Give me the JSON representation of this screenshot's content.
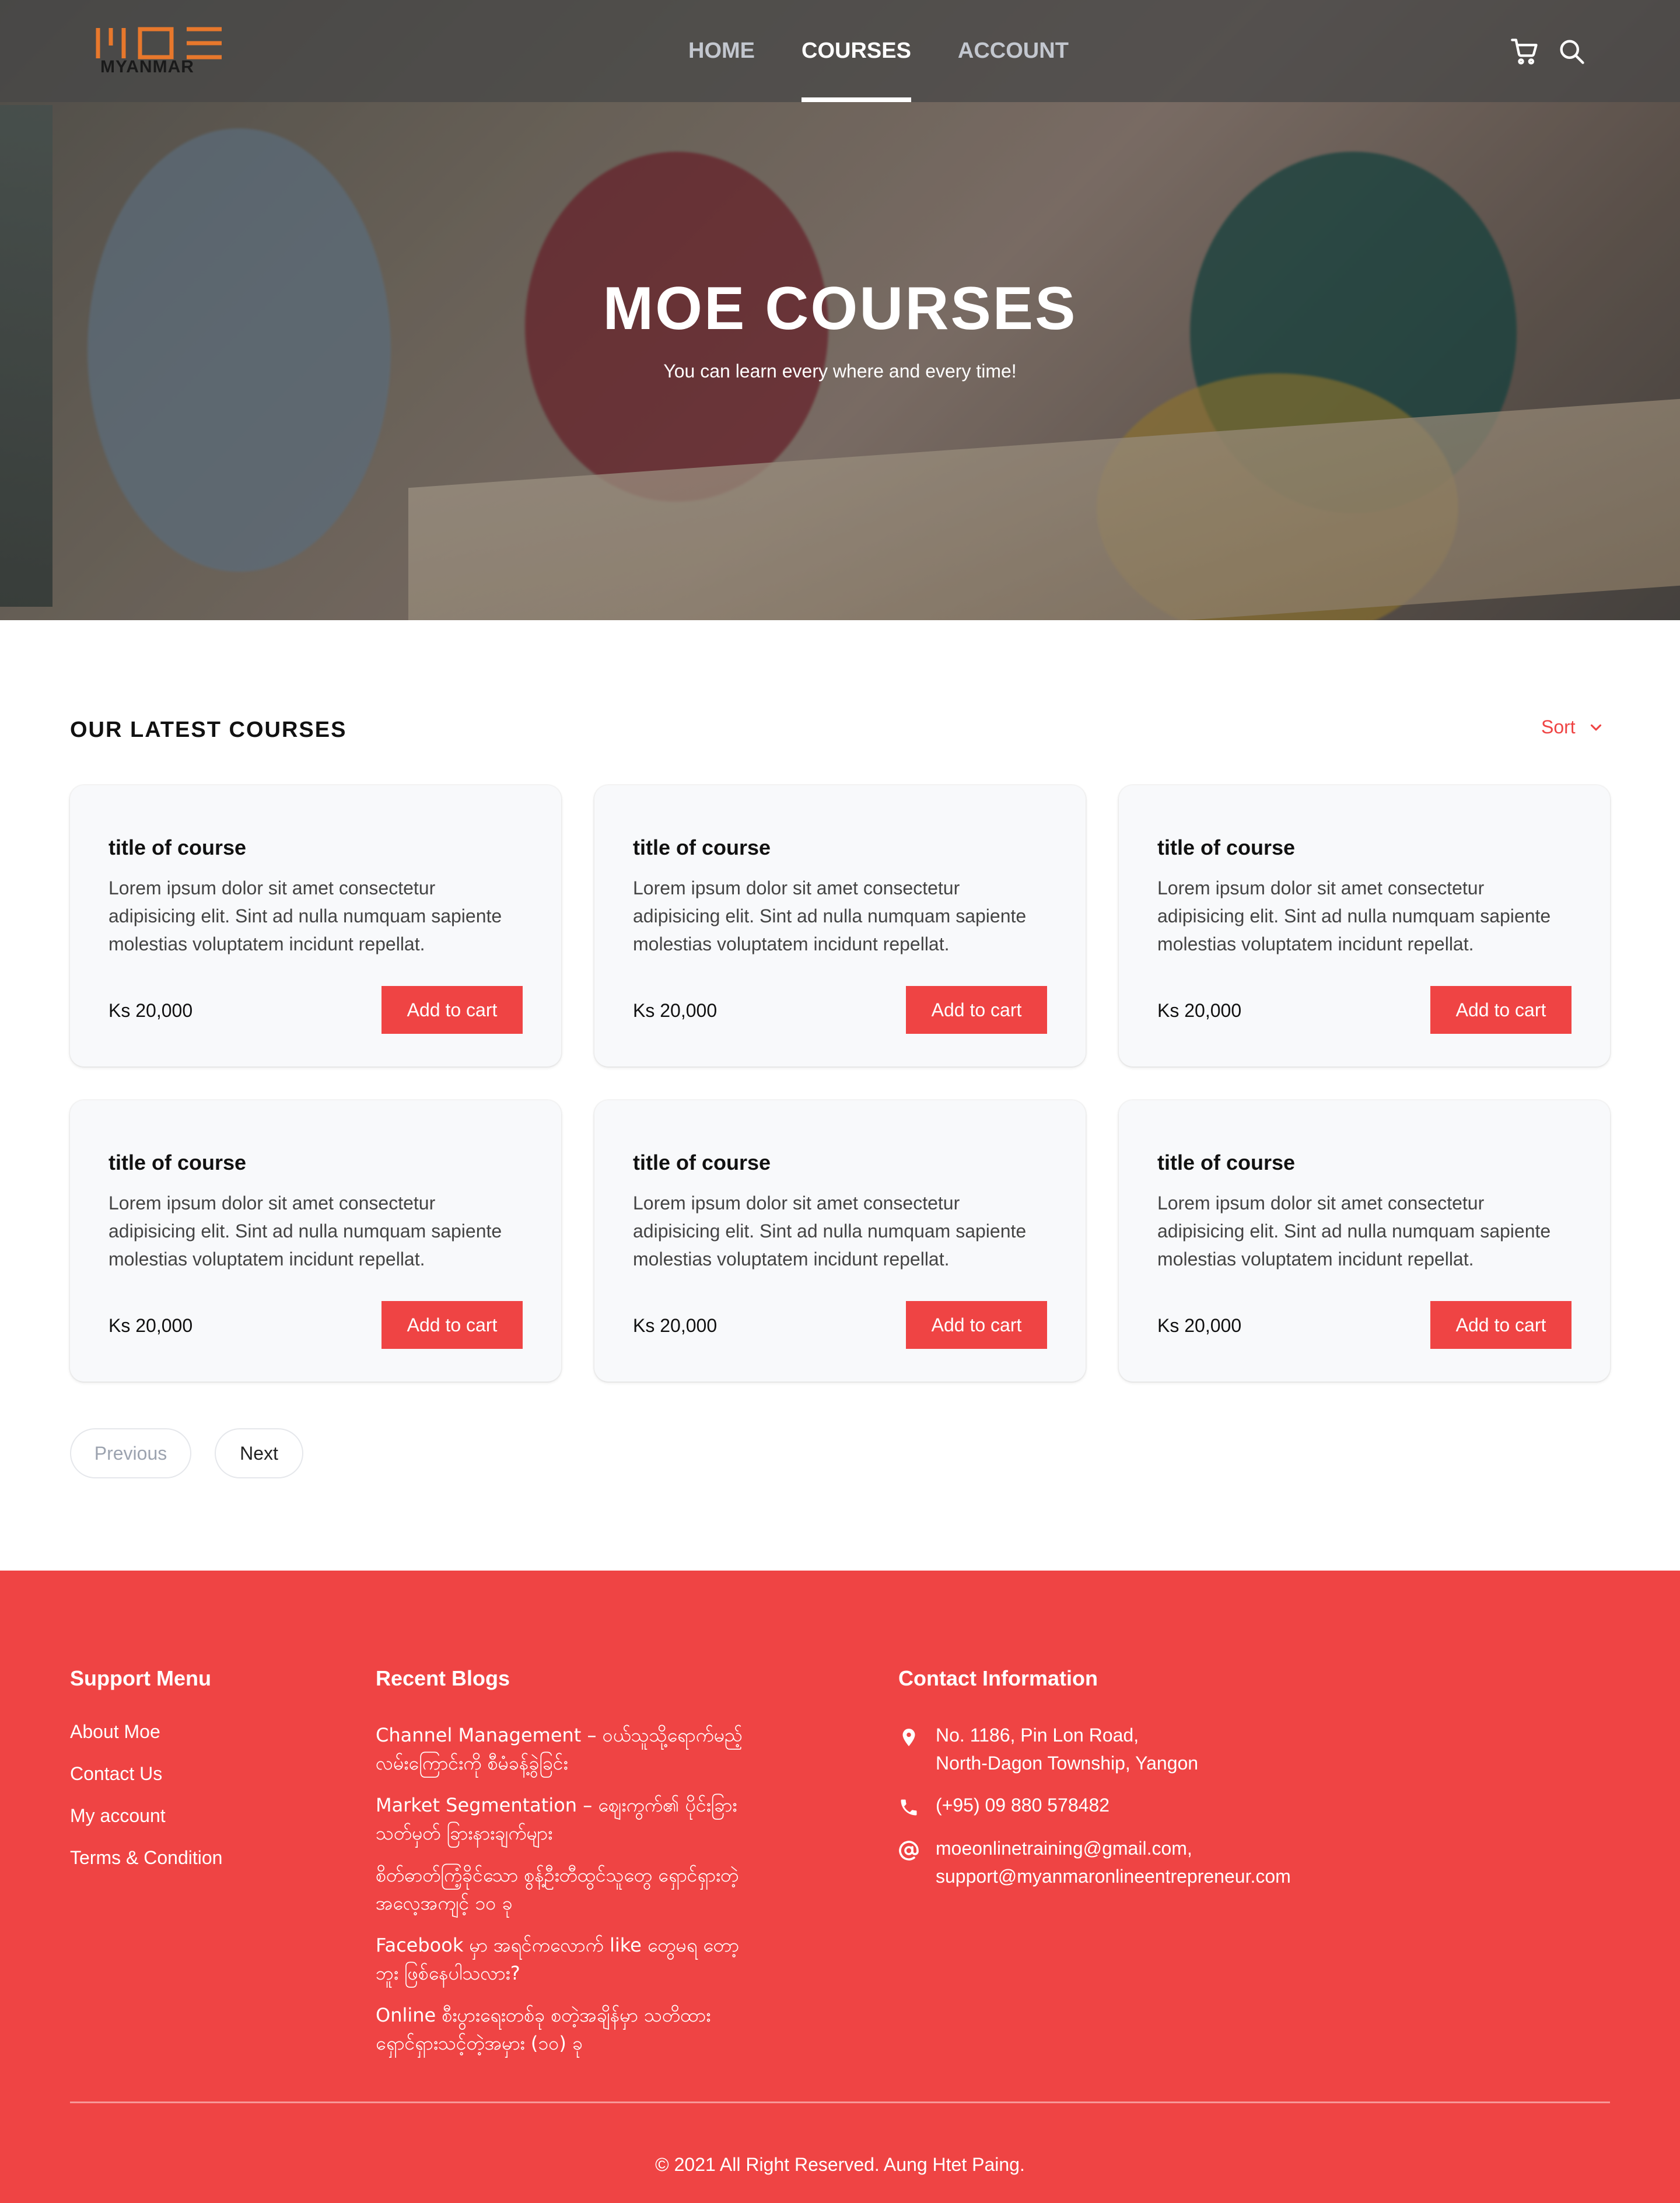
{
  "brand": {
    "logo_text": "MYANMAR",
    "logo_letters": "MOE"
  },
  "nav": {
    "links": [
      {
        "label": "HOME"
      },
      {
        "label": "COURSES"
      },
      {
        "label": "ACCOUNT"
      }
    ],
    "icons": [
      "cart-icon",
      "search-icon"
    ]
  },
  "hero": {
    "title": "MOE COURSES",
    "subtitle": "You can learn every where and every time!"
  },
  "courses": {
    "section_title": "OUR LATEST COURSES",
    "sort_label": "Sort",
    "items": [
      {
        "title": "title of course",
        "description": "Lorem ipsum dolor sit amet consectetur adipisicing elit. Sint ad nulla numquam sapiente molestias voluptatem incidunt repellat.",
        "price": "Ks 20,000",
        "button": "Add to cart"
      },
      {
        "title": "title of course",
        "description": "Lorem ipsum dolor sit amet consectetur adipisicing elit. Sint ad nulla numquam sapiente molestias voluptatem incidunt repellat.",
        "price": "Ks 20,000",
        "button": "Add to cart"
      },
      {
        "title": "title of course",
        "description": "Lorem ipsum dolor sit amet consectetur adipisicing elit. Sint ad nulla numquam sapiente molestias voluptatem incidunt repellat.",
        "price": "Ks 20,000",
        "button": "Add to cart"
      },
      {
        "title": "title of course",
        "description": "Lorem ipsum dolor sit amet consectetur adipisicing elit. Sint ad nulla numquam sapiente molestias voluptatem incidunt repellat.",
        "price": "Ks 20,000",
        "button": "Add to cart"
      },
      {
        "title": "title of course",
        "description": "Lorem ipsum dolor sit amet consectetur adipisicing elit. Sint ad nulla numquam sapiente molestias voluptatem incidunt repellat.",
        "price": "Ks 20,000",
        "button": "Add to cart"
      },
      {
        "title": "title of course",
        "description": "Lorem ipsum dolor sit amet consectetur adipisicing elit. Sint ad nulla numquam sapiente molestias voluptatem incidunt repellat.",
        "price": "Ks 20,000",
        "button": "Add to cart"
      }
    ],
    "pagination": {
      "previous": "Previous",
      "next": "Next"
    }
  },
  "footer": {
    "support": {
      "heading": "Support Menu",
      "links": [
        "About Moe",
        "Contact Us",
        "My account",
        "Terms & Condition"
      ]
    },
    "blogs": {
      "heading": "Recent Blogs",
      "items": [
        "Channel Management – ဝယ်သူသို့ရောက်မည့် လမ်းကြောင်းကို စီမံခန့်ခွဲခြင်း",
        "Market Segmentation – ဈေးကွက်၏ ပိုင်းခြား သတ်မှတ် ခြားနားချက်များ",
        "စိတ်ဓာတ်ကြံ့ခိုင်သော စွန့်ဦးတီထွင်သူတွေ ရှောင်ရှားတဲ့ အလေ့အကျင့် ၁၀ ခု",
        "Facebook မှာ အရင်ကလောက် like တွေမရ တော့ဘူး ဖြစ်နေပါသလား?",
        "Online စီးပွားရေးတစ်ခု စတဲ့အချိန်မှာ သတိထား ရှောင်ရှားသင့်တဲ့အမှား (၁၀) ခု"
      ]
    },
    "contact": {
      "heading": "Contact Information",
      "address_line1": "No. 1186, Pin Lon Road,",
      "address_line2": "North-Dagon Township, Yangon",
      "phone": "(+95) 09 880 578482",
      "email_line1": "moeonlinetraining@gmail.com,",
      "email_line2": "support@myanmaronlineentrepreneur.com"
    },
    "copyright": "© 2021 All Right Reserved. Aung Htet Paing."
  },
  "colors": {
    "accent": "#ef4444",
    "nav_bg": "#4a4a4a",
    "card_bg": "#f8f9fb",
    "logo": "#e8782c"
  }
}
